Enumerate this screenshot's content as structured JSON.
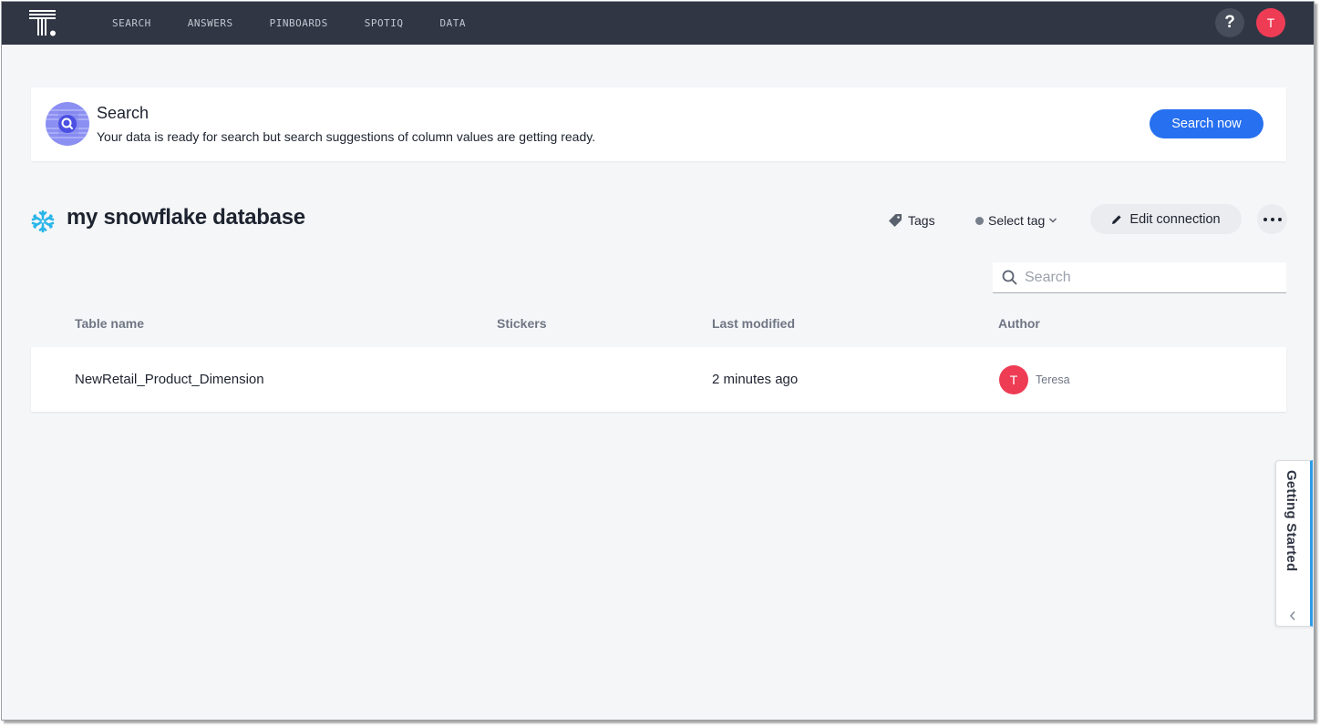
{
  "nav": {
    "logo": "thoughtspot-logo",
    "items": [
      {
        "label": "SEARCH"
      },
      {
        "label": "ANSWERS"
      },
      {
        "label": "PINBOARDS"
      },
      {
        "label": "SPOTIQ"
      },
      {
        "label": "DATA"
      }
    ],
    "help_label": "?",
    "user_initial": "T"
  },
  "banner": {
    "icon": "search-icon",
    "title": "Search",
    "message": "Your data is ready for search but search suggestions of column values are getting ready.",
    "button_label": "Search now"
  },
  "header": {
    "icon": "snowflake-icon",
    "title": "my snowflake database",
    "tags_label": "Tags",
    "select_tag_label": "Select tag",
    "edit_connection_label": "Edit connection",
    "more_icon": "more-horizontal-icon"
  },
  "search": {
    "placeholder": "Search",
    "value": ""
  },
  "table": {
    "columns": [
      "Table name",
      "Stickers",
      "Last modified",
      "Author"
    ],
    "rows": [
      {
        "name": "NewRetail_Product_Dimension",
        "stickers": "",
        "last_modified": "2 minutes ago",
        "author_initial": "T",
        "author_name": "Teresa"
      }
    ]
  },
  "getting_started": {
    "label": "Getting Started"
  },
  "colors": {
    "nav_bg": "#303644",
    "accent": "#2770ef",
    "avatar": "#ef3c55",
    "snowflake": "#29b5e8",
    "page_bg": "#f5f6f8"
  }
}
